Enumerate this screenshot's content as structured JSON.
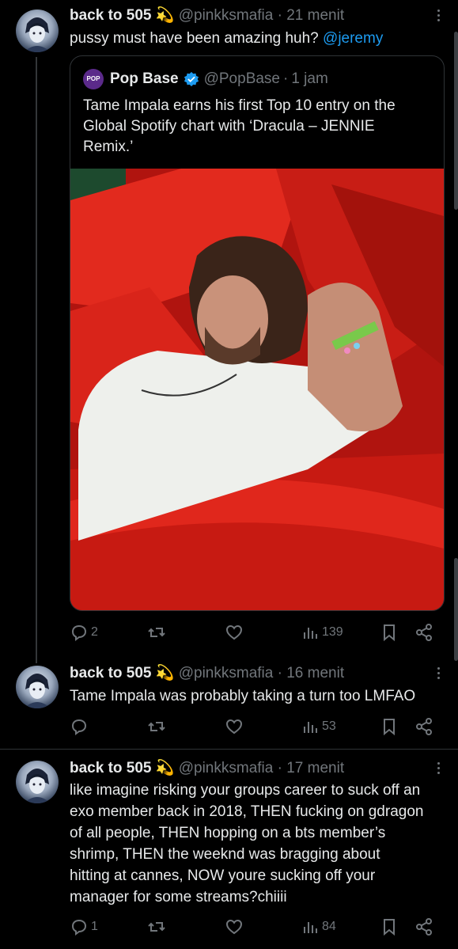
{
  "tweets": [
    {
      "name": "back to 505",
      "emoji": "💫",
      "handle": "@pinkksmafia",
      "time": "21 menit",
      "text_pre": "pussy must have been amazing huh? ",
      "mention": "@jeremy",
      "stats": {
        "replies": "2",
        "views": "139"
      }
    },
    {
      "name": "back to 505",
      "emoji": "💫",
      "handle": "@pinkksmafia",
      "time": "16 menit",
      "text": "Tame Impala was probably taking a turn too LMFAO",
      "stats": {
        "views": "53"
      }
    },
    {
      "name": "back to 505",
      "emoji": "💫",
      "handle": "@pinkksmafia",
      "time": "17 menit",
      "lines": [
        "like imagine risking your groups career to suck off an",
        "exo member back in 2018, THEN fucking on gdragon",
        "of all people, THEN hopping on a bts member’s",
        "shrimp, THEN the weeknd was bragging about",
        "hitting at cannes, NOW youre sucking off your",
        "manager for some streams?chiiii"
      ],
      "stats": {
        "replies": "1",
        "views": "84"
      }
    }
  ],
  "quote": {
    "name": "Pop Base",
    "handle": "@PopBase",
    "time": "1 jam",
    "lines": [
      "Tame Impala earns his first Top 10 entry on the",
      "Global Spotify chart with ‘Dracula – JENNIE",
      "Remix.’"
    ]
  },
  "colors": {
    "accent": "#1d9bf0",
    "muted": "#71767b",
    "text": "#e7e9ea",
    "divider": "#2f3336",
    "photo_red": "#d4211a"
  },
  "icons": [
    "reply-icon",
    "retweet-icon",
    "like-icon",
    "views-icon",
    "bookmark-icon",
    "share-icon",
    "more-icon",
    "verified-icon"
  ]
}
